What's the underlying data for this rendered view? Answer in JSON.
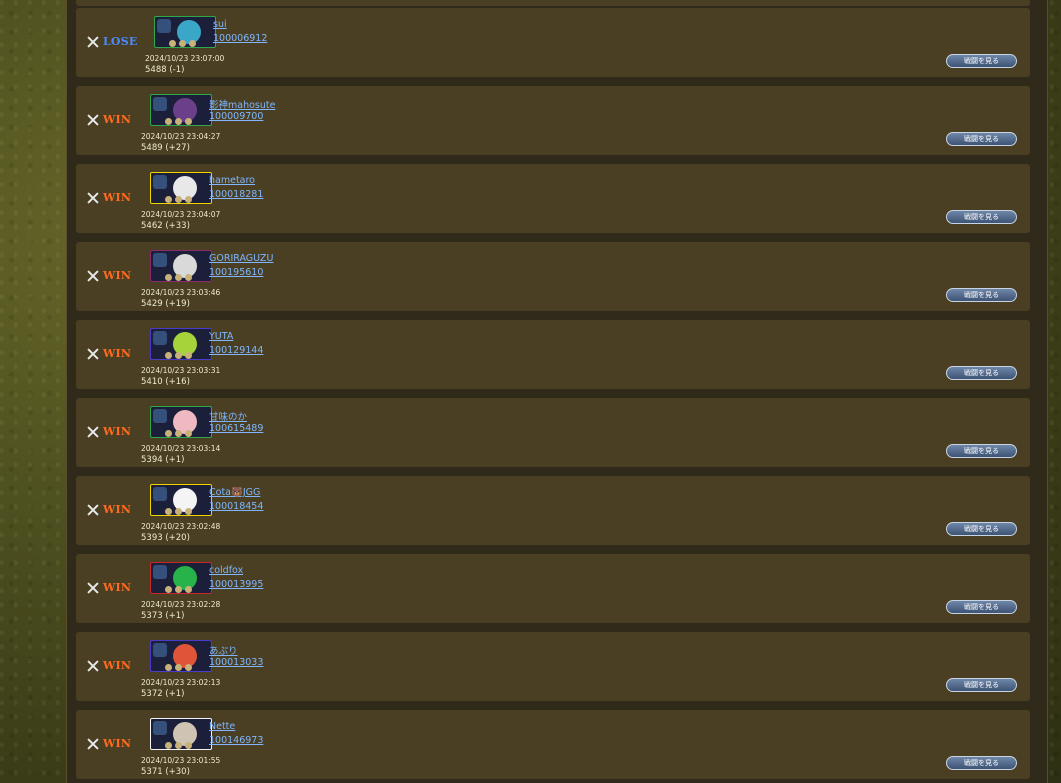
{
  "matches": [
    {
      "result": "LOSE",
      "result_color": "#4a8cff",
      "name": "sui",
      "id": "100006912",
      "datetime": "2024/10/23 23:07:00",
      "score": "5488 (-1)",
      "button": "戦闘を見る",
      "frame": "#2ea84a",
      "avatar_color": "#3aa7c9"
    },
    {
      "result": "WIN",
      "result_color": "#ff6a1e",
      "name": "影神mahosute",
      "id": "100009700",
      "datetime": "2024/10/23 23:04:27",
      "score": "5489 (+27)",
      "button": "戦闘を見る",
      "frame": "#2ea84a",
      "avatar_color": "#6c3f8a"
    },
    {
      "result": "WIN",
      "result_color": "#ff6a1e",
      "name": "hametaro",
      "id": "100018281",
      "datetime": "2024/10/23 23:04:07",
      "score": "5462 (+33)",
      "button": "戦闘を見る",
      "frame": "#f0d400",
      "avatar_color": "#e8e8e8"
    },
    {
      "result": "WIN",
      "result_color": "#ff6a1e",
      "name": "GORIRAGUZU",
      "id": "100195610",
      "datetime": "2024/10/23 23:03:46",
      "score": "5429 (+19)",
      "button": "戦闘を見る",
      "frame": "#8a2a6a",
      "avatar_color": "#d9d9d9"
    },
    {
      "result": "WIN",
      "result_color": "#ff6a1e",
      "name": "YUTA",
      "id": "100129144",
      "datetime": "2024/10/23 23:03:31",
      "score": "5410 (+16)",
      "button": "戦闘を見る",
      "frame": "#4a3cc8",
      "avatar_color": "#a6d23a"
    },
    {
      "result": "WIN",
      "result_color": "#ff6a1e",
      "name": "甘味のか",
      "id": "100615489",
      "datetime": "2024/10/23 23:03:14",
      "score": "5394 (+1)",
      "button": "戦闘を見る",
      "frame": "#2ea84a",
      "avatar_color": "#f0b8c0"
    },
    {
      "result": "WIN",
      "result_color": "#ff6a1e",
      "name": "Cota🐻JGG",
      "id": "100018454",
      "datetime": "2024/10/23 23:02:48",
      "score": "5393 (+20)",
      "button": "戦闘を見る",
      "frame": "#f0d400",
      "avatar_color": "#f4f4f4"
    },
    {
      "result": "WIN",
      "result_color": "#ff6a1e",
      "name": "coldfox",
      "id": "100013995",
      "datetime": "2024/10/23 23:02:28",
      "score": "5373 (+1)",
      "button": "戦闘を見る",
      "frame": "#c8282a",
      "avatar_color": "#27b24a"
    },
    {
      "result": "WIN",
      "result_color": "#ff6a1e",
      "name": "あぷり",
      "id": "100013033",
      "datetime": "2024/10/23 23:02:13",
      "score": "5372 (+1)",
      "button": "戦闘を見る",
      "frame": "#4a3cc8",
      "avatar_color": "#e0553a"
    },
    {
      "result": "WIN",
      "result_color": "#ff6a1e",
      "name": "Nette",
      "id": "100146973",
      "datetime": "2024/10/23 23:01:55",
      "score": "5371 (+30)",
      "button": "戦闘を見る",
      "frame": "#f4f4f4",
      "avatar_color": "#cfc4b4"
    }
  ]
}
